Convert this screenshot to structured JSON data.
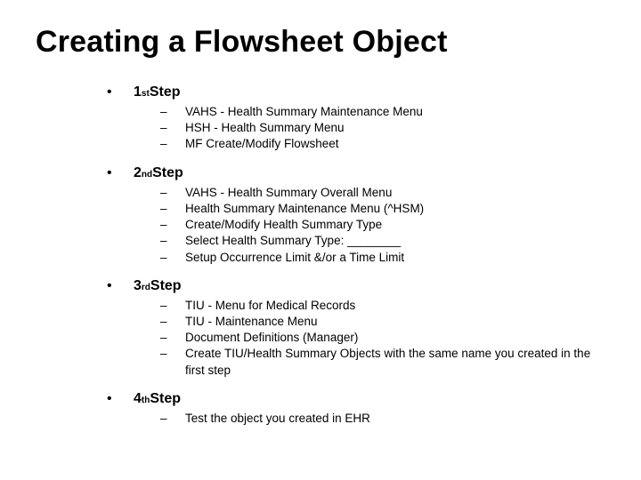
{
  "title": "Creating a Flowsheet Object",
  "steps": [
    {
      "num": "1",
      "ord": "st",
      "label": " Step",
      "items": [
        "VAHS - Health Summary Maintenance Menu",
        "HSH - Health Summary Menu",
        "MF Create/Modify Flowsheet"
      ]
    },
    {
      "num": "2",
      "ord": "nd",
      "label": " Step",
      "items": [
        "VAHS - Health Summary Overall Menu",
        "Health Summary Maintenance Menu (^HSM)",
        "Create/Modify Health Summary Type",
        "Select Health Summary Type: ________",
        "Setup Occurrence Limit &/or a Time Limit"
      ]
    },
    {
      "num": "3",
      "ord": "rd",
      "label": " Step",
      "items": [
        "TIU - Menu for Medical Records",
        "TIU - Maintenance Menu",
        "Document Definitions (Manager)",
        "Create TIU/Health Summary Objects with the same name you created in the first step"
      ]
    },
    {
      "num": "4",
      "ord": "th",
      "label": " Step",
      "items": [
        "Test the object you created in EHR"
      ]
    }
  ]
}
